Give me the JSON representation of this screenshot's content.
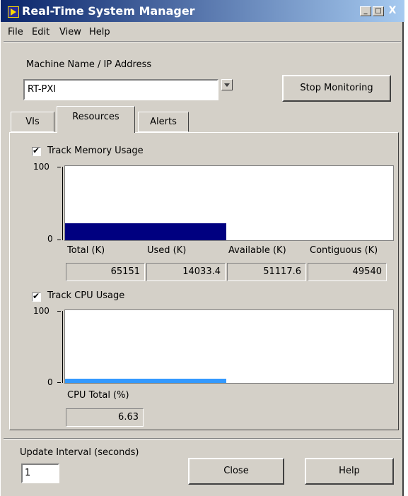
{
  "window": {
    "title": "Real-Time System Manager"
  },
  "titlebar": {
    "minimize": "_",
    "maximize": "□",
    "close": "X"
  },
  "menu": [
    "File",
    "Edit",
    "View",
    "Help"
  ],
  "machine": {
    "label": "Machine Name / IP Address",
    "value": "RT-PXI"
  },
  "stop_button": "Stop Monitoring",
  "tabs": [
    "VIs",
    "Resources",
    "Alerts"
  ],
  "active_tab": "Resources",
  "memory": {
    "checkbox_label": "Track Memory Usage",
    "checked": true,
    "axis": {
      "max_label": "100",
      "min_label": "0"
    },
    "columns": [
      "Total (K)",
      "Used (K)",
      "Available (K)",
      "Contiguous (K)"
    ],
    "values": [
      "65151",
      "14033.4",
      "51117.6",
      "49540"
    ],
    "bar_color": "#000080"
  },
  "cpu": {
    "checkbox_label": "Track CPU Usage",
    "checked": true,
    "axis": {
      "max_label": "100",
      "min_label": "0"
    },
    "label": "CPU Total (%)",
    "value": "6.63",
    "bar_color": "#3399ff"
  },
  "update": {
    "label": "Update Interval (seconds)",
    "value": "1"
  },
  "close_button": "Close",
  "help_button": "Help"
}
